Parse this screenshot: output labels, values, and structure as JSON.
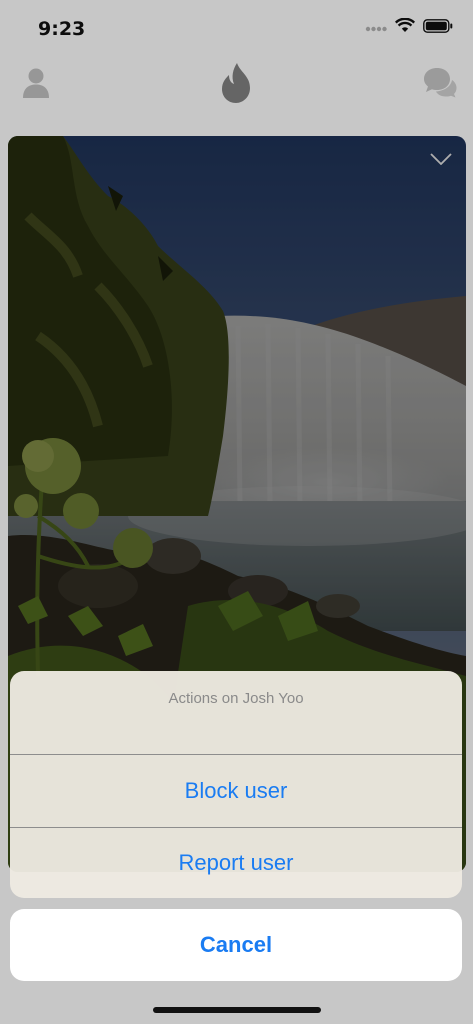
{
  "status_bar": {
    "time": "9:23"
  },
  "nav": {
    "left_icon": "profile-icon",
    "center_icon": "flame-icon",
    "right_icon": "chat-bubbles-icon"
  },
  "card": {
    "collapse_icon": "chevron-down-icon"
  },
  "action_sheet": {
    "title": "Actions on Josh Yoo",
    "actions": [
      {
        "label": "Block user"
      },
      {
        "label": "Report user"
      }
    ],
    "cancel_label": "Cancel"
  },
  "colors": {
    "action": "#1a7cf2",
    "title": "#8a8a8a"
  }
}
